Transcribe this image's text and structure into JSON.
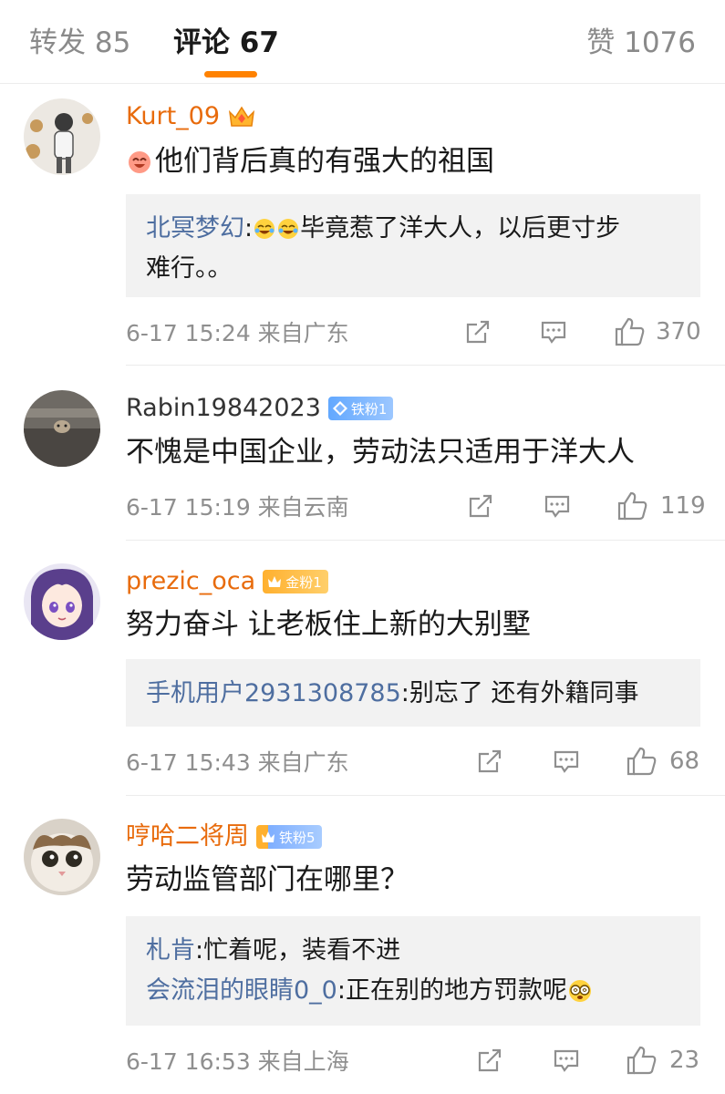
{
  "tabs": {
    "repost": "转发 85",
    "comments": "评论 67",
    "likes": "赞 1076"
  },
  "colors": {
    "accent": "#ff8200",
    "vip_name": "#e86b0c",
    "reply_name": "#4e6ea0",
    "meta": "#8f8f8f"
  },
  "comments": [
    {
      "username": "Kurt_09",
      "badge": "crown-icon",
      "text": "他们背后真的有强大的祖国",
      "leading_emoji": "haha-emoji-icon",
      "reply": {
        "name": "北冥梦幻",
        "sep": ": ",
        "line1": "毕竟惹了洋大人，以后更寸步",
        "line2": "难行。。"
      },
      "meta": "6-17 15:24  来自广东",
      "likes": "370"
    },
    {
      "username": "Rabin19842023",
      "fan_badge": "铁粉1",
      "text": "不愧是中国企业，劳动法只适用于洋大人",
      "meta": "6-17 15:19  来自云南",
      "likes": "119"
    },
    {
      "username": "prezic_oca",
      "fan_badge": "金粉1",
      "text": "努力奋斗 让老板住上新的大别墅",
      "reply": {
        "name": "手机用户2931308785",
        "sep": ": ",
        "line1": "别忘了 还有外籍同事"
      },
      "meta": "6-17 15:43  来自广东",
      "likes": "68"
    },
    {
      "username": "哼哈二将周",
      "fan_badge": "铁粉5",
      "text": "劳动监管部门在哪里？",
      "replies": [
        {
          "name": "札肯",
          "sep": ": ",
          "text": "忙着呢，装看不进"
        },
        {
          "name": "会流泪的眼睛0_0",
          "sep": ": ",
          "text": "正在别的地方罚款呢"
        }
      ],
      "meta": "6-17 16:53  来自上海",
      "likes": "23"
    }
  ]
}
